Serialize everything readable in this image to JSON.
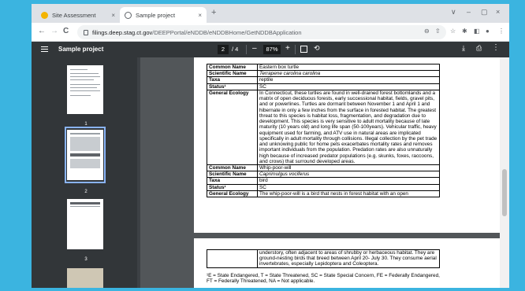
{
  "browser": {
    "tabs": [
      {
        "title": "Site Assessment",
        "active": false,
        "favicon_color": "#f4b400"
      },
      {
        "title": "Sample project",
        "active": true,
        "favicon_color": "#5f6368"
      }
    ],
    "close_label": "×",
    "new_tab_label": "+",
    "window_buttons": [
      "∨",
      "–",
      "▢",
      "×"
    ],
    "nav": {
      "back": "←",
      "forward": "→",
      "reload": "C"
    },
    "url_host": "filings.deep.stag.ct.gov",
    "url_path": "/DEEPPortal/eNDDB/eNDDBHome/GetNDDBApplication",
    "right_icons": [
      "⊖",
      "⇧",
      "☆",
      "✱",
      "◧",
      "●",
      "⋮"
    ]
  },
  "pdf_toolbar": {
    "title": "Sample project",
    "current_page": "2",
    "total_pages": "/ 4",
    "zoom_out": "–",
    "zoom": "87%",
    "zoom_in": "+",
    "rotate": "⟲",
    "download": "⤓",
    "print": "⎙",
    "more": "⋮"
  },
  "thumbnails": [
    "1",
    "2",
    "3"
  ],
  "page1_table": [
    {
      "key": "Common Name",
      "value": "Eastern box turtle"
    },
    {
      "key": "Scientific Name",
      "value": "Terrapene carolina carolina",
      "italic": true
    },
    {
      "key": "Taxa",
      "value": "reptile"
    },
    {
      "key": "Status¹",
      "value": "SC"
    },
    {
      "key": "General Ecology",
      "value": "In Connecticut, these turtles are found in well-drained forest bottomlands and a matrix of open deciduous forests, early successional habitat, fields, gravel pits, and or powerlines. Turtles are dormant between November 1 and April 1 and hibernate in only a few inches from the surface in forested habitat. The greatest threat to this species is habitat loss, fragmentation, and degradation due to development. This species is very sensitive to adult mortality because of late maturity (10 years old) and long life span (50-100years). Vehicular traffic, heavy equipment used for farming, and ATV use in natural areas are implicated specifically in adult mortality through collisions. Illegal collection by the pet trade and unknowing public for home pets exacerbates mortality rates and removes important individuals from the population. Predation rates are also unnaturally high because of increased predator populations (e.g. skunks, foxes, raccoons, and crows) that surround developed areas."
    },
    {
      "key": "Common Name",
      "value": "Whip-poor-will"
    },
    {
      "key": "Scientific Name",
      "value": "Caprimulgus vociferus",
      "italic": true
    },
    {
      "key": "Taxa",
      "value": "bird"
    },
    {
      "key": "Status¹",
      "value": "SC"
    },
    {
      "key": "General Ecology",
      "value": "The whip-poor-will is a bird that nests in forest habitat with an open"
    }
  ],
  "page2_table": [
    {
      "key": "",
      "value": "understory, often adjacent to areas of shrubby or herbaceous habitat. They are ground-nesting birds that breed between April 20- July 30. They consume aerial invertebrates, especially Lepidoptera and Coleoptera."
    }
  ],
  "footnote": "¹E = State Endangered, T = State Threatened, SC = State Special Concern, FE = Federally Endangered, FT = Federally Threatened, NA = Not applicable."
}
